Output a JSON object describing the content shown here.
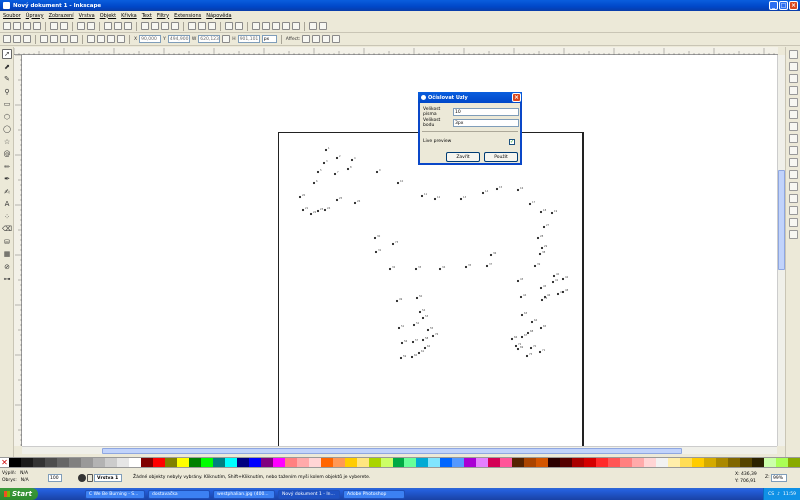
{
  "window": {
    "title": "Nový dokument 1 - Inkscape",
    "min": "_",
    "max": "□",
    "close": "×"
  },
  "menu": [
    "Soubor",
    "Úpravy",
    "Zobrazení",
    "Vrstva",
    "Objekt",
    "Křivka",
    "Text",
    "Filtry",
    "Extensions",
    "Nápověda"
  ],
  "controls": {
    "x_label": "X",
    "x_value": "90,000",
    "y_label": "Y",
    "y_value": "494,900",
    "w_label": "W",
    "w_value": "620,123",
    "h_label": "H",
    "h_value": "901,101",
    "unit": "px",
    "affect": "Affect:"
  },
  "dialog": {
    "title": "Očíslovat Uzly",
    "font_size_label": "Velikost písma",
    "font_size_value": "10",
    "dot_size_label": "Velikost bodu",
    "dot_size_value": "3px",
    "live_preview_label": "Live preview",
    "live_preview_checked": "✓",
    "close_button": "Zavřít",
    "apply_button": "Použít"
  },
  "status": {
    "fill_label": "Výplň:",
    "fill_value": "N/A",
    "stroke_label": "Obrys:",
    "stroke_value": "N/A",
    "opacity": "100",
    "layer": "Vrstva 1",
    "message": "Žádné objekty nebyly vybrány. Kliknutím, Shift+Kliknutím, nebo tažením myši kolem objektů je vyberete.",
    "x_coord": "X: 436,39",
    "y_coord": "Y: 706,91",
    "zoom_label": "Z:",
    "zoom": "99%"
  },
  "taskbar": {
    "start": "Start",
    "tasks": [
      "C We Be Burning - S...",
      "dostavačka",
      "westphalian.jpg (400...",
      "Nový dokument 1 - In...",
      "Adobe Photoshop"
    ],
    "tray_lang": "CS",
    "clock": "11:59"
  },
  "colors": {
    "titlebar": "#0a5ede",
    "chrome": "#ece9d8",
    "selection": "#c1d3fb"
  }
}
